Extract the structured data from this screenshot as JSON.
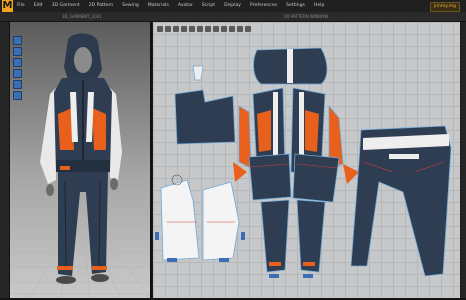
{
  "app": {
    "logo_text": "M",
    "user_label": "jimmy.mg"
  },
  "menu": [
    "File",
    "Edit",
    "3D Garment",
    "2D Pattern",
    "Sewing",
    "Materials",
    "Avatar",
    "Script",
    "Display",
    "Preferences",
    "Settings",
    "Help"
  ],
  "windows": {
    "view3d_title": "3D_GARMENT_2021",
    "view2d_title": "2D PATTERN WINDOW"
  },
  "colors": {
    "fabric_navy": "#2e3d52",
    "accent_orange": "#e8601c",
    "accent_white": "#eeeeee",
    "stitch_blue": "#6fa9d8",
    "stitch_red": "#d83a3a",
    "brand_orange": "#f2a51b"
  },
  "icons": {
    "view3d_tools": [
      "select-icon",
      "move-icon",
      "rotate-icon",
      "scale-icon",
      "pin-icon",
      "fold-icon"
    ],
    "view2d_tools": [
      "edit-pattern-icon",
      "transform-icon",
      "segment-icon",
      "point-icon",
      "curve-icon",
      "rectangle-icon",
      "polygon-icon",
      "circle-icon",
      "dart-icon",
      "sew-icon",
      "free-sew-icon",
      "zoom-icon"
    ]
  }
}
